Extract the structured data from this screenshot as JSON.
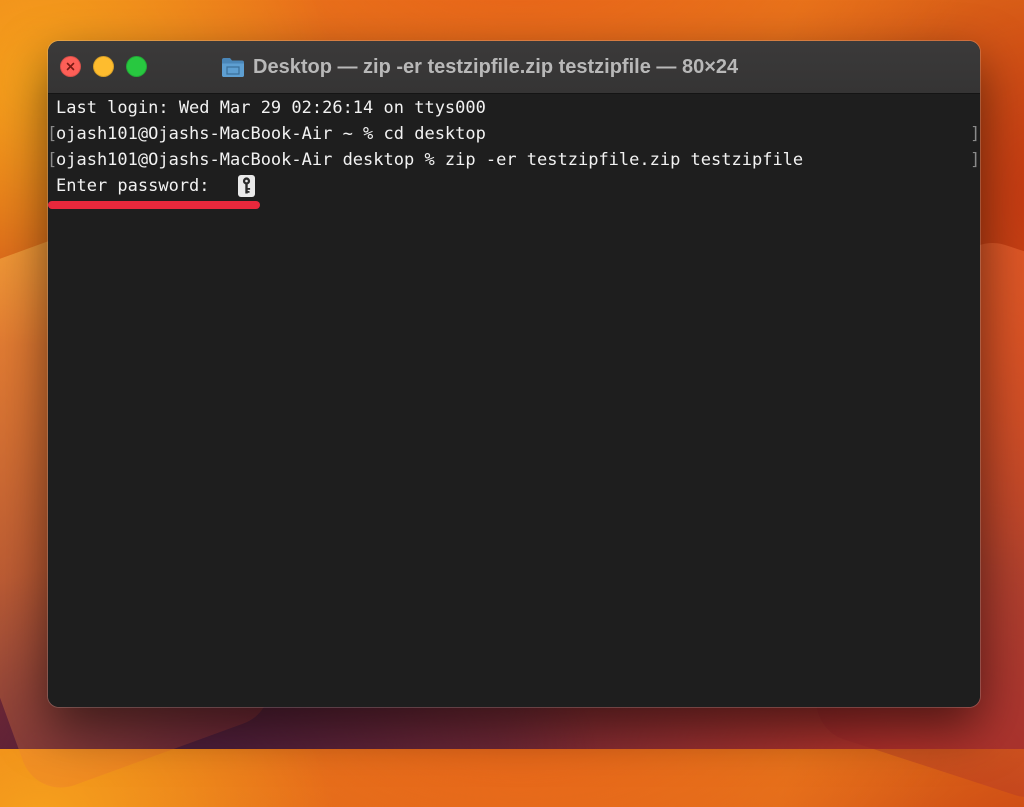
{
  "window": {
    "title": "Desktop — zip -er testzipfile.zip testzipfile — 80×24",
    "title_icon": "folder-icon",
    "buttons": [
      "close",
      "minimize",
      "zoom"
    ]
  },
  "terminal": {
    "lines": [
      "Last login: Wed Mar 29 02:26:14 on ttys000",
      "ojash101@Ojashs-MacBook-Air ~ % cd desktop",
      "ojash101@Ojashs-MacBook-Air desktop % zip -er testzipfile.zip testzipfile",
      "Enter password: "
    ],
    "cursor_icon": "key-icon",
    "highlight_color": "#e8283c"
  },
  "colors": {
    "close": "#fe5f57",
    "minimize": "#febc2e",
    "zoom": "#28c840",
    "terminal_bg": "#1e1e1e"
  }
}
